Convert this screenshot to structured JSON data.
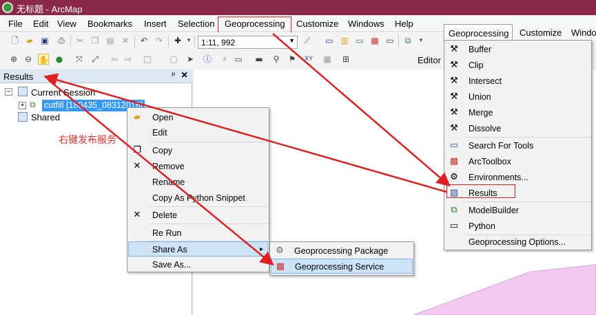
{
  "window": {
    "title": "无标题 - ArcMap"
  },
  "menubar": {
    "items": [
      {
        "id": "file",
        "label": "File"
      },
      {
        "id": "edit",
        "label": "Edit"
      },
      {
        "id": "view",
        "label": "View"
      },
      {
        "id": "bookmarks",
        "label": "Bookmarks"
      },
      {
        "id": "insert",
        "label": "Insert"
      },
      {
        "id": "selection",
        "label": "Selection"
      },
      {
        "id": "geoprocessing",
        "label": "Geoprocessing"
      },
      {
        "id": "customize",
        "label": "Customize"
      },
      {
        "id": "windows",
        "label": "Windows"
      },
      {
        "id": "help",
        "label": "Help"
      }
    ]
  },
  "toolbar": {
    "scale": "1:11, 992",
    "editor_label": "Editor"
  },
  "results_panel": {
    "title": "Results",
    "pin_glyph": "ᵖ",
    "close_glyph": "×",
    "current_session": "Current Session",
    "result_item": "cutfill [180435_08312018]",
    "shared": "Shared"
  },
  "annotation": {
    "chinese_label": "右键发布服务",
    "color": "#e83030"
  },
  "context_menu": {
    "items": [
      {
        "label": "Open",
        "icon": "folder-open-icon"
      },
      {
        "label": "Edit",
        "icon": ""
      },
      {
        "label": "Copy",
        "icon": "copy-icon"
      },
      {
        "label": "Remove",
        "icon": "remove-icon"
      },
      {
        "label": "Rename",
        "icon": ""
      },
      {
        "label": "Copy As Python Snippet",
        "icon": ""
      },
      {
        "label": "Delete",
        "icon": "delete-icon"
      },
      {
        "label": "Re Run",
        "icon": ""
      },
      {
        "label": "Share As",
        "icon": "",
        "submenu_arrow": "▸"
      },
      {
        "label": "Save As...",
        "icon": ""
      }
    ]
  },
  "share_submenu": {
    "items": [
      {
        "label": "Geoprocessing Package",
        "icon": "package-icon"
      },
      {
        "label": "Geoprocessing Service",
        "icon": "service-icon"
      }
    ]
  },
  "geo_menu": {
    "tabs": [
      {
        "label": "Geoprocessing"
      },
      {
        "label": "Customize"
      },
      {
        "label": "Windo"
      }
    ],
    "items": [
      {
        "label": "Buffer",
        "icon": "hammer-icon"
      },
      {
        "label": "Clip",
        "icon": "hammer-icon"
      },
      {
        "label": "Intersect",
        "icon": "hammer-icon"
      },
      {
        "label": "Union",
        "icon": "hammer-icon"
      },
      {
        "label": "Merge",
        "icon": "hammer-icon"
      },
      {
        "label": "Dissolve",
        "icon": "hammer-icon"
      },
      {
        "label": "Search For Tools",
        "icon": "search-window-icon"
      },
      {
        "label": "ArcToolbox",
        "icon": "toolbox-icon"
      },
      {
        "label": "Environments...",
        "icon": "wrench-icon"
      },
      {
        "label": "Results",
        "icon": "results-icon"
      },
      {
        "label": "ModelBuilder",
        "icon": "modelbuilder-icon"
      },
      {
        "label": "Python",
        "icon": "python-window-icon"
      },
      {
        "label": "Geoprocessing Options...",
        "icon": ""
      }
    ]
  },
  "colors": {
    "title_bar": "#8b2a48",
    "highlight": "#cde4f7",
    "annotation_red": "#e02020",
    "map_polygon": "#f3c9f0"
  }
}
